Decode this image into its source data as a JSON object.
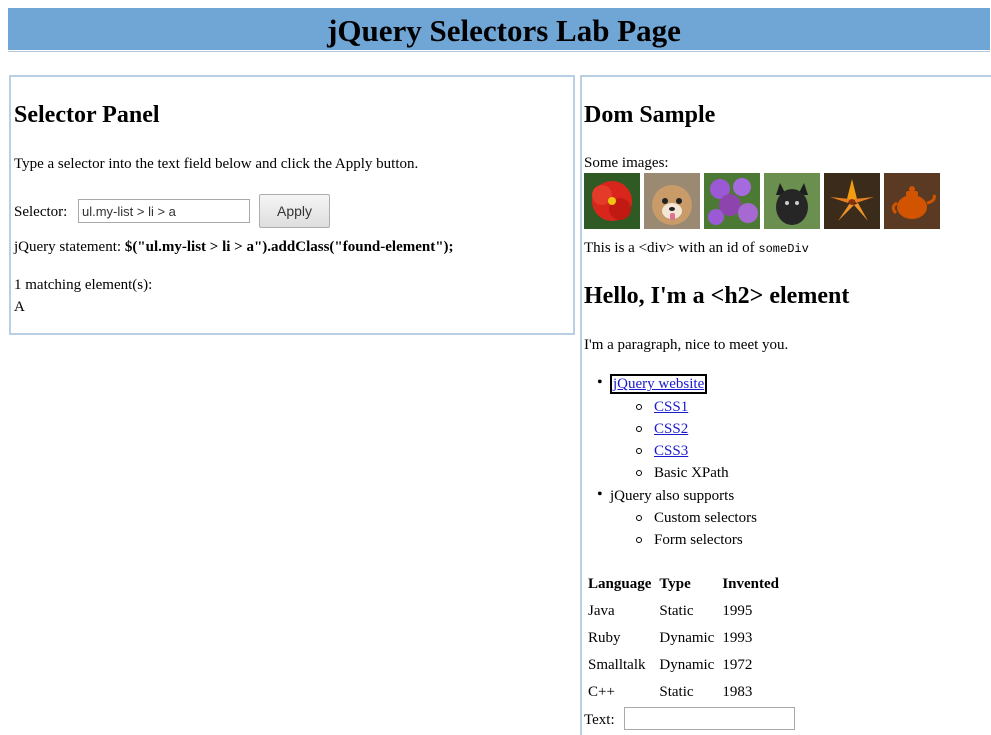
{
  "header": {
    "title": "jQuery Selectors Lab Page"
  },
  "selector_panel": {
    "title": "Selector Panel",
    "instructions": "Type a selector into the text field below and click the Apply button.",
    "selector_label": "Selector:",
    "selector_value": "ul.my-list > li > a",
    "apply_label": "Apply",
    "statement_label": "jQuery statement:",
    "statement_code": "$(\"ul.my-list > li > a\").addClass(\"found-element\");",
    "match_count": "1",
    "match_suffix": "matching element(s):",
    "match_result": "A"
  },
  "dom_panel": {
    "title": "Dom Sample",
    "images_label": "Some images:",
    "images": [
      {
        "name": "red-hibiscus-flower-image",
        "color": "#c0392b"
      },
      {
        "name": "dog-image",
        "color": "#8a6a4f"
      },
      {
        "name": "purple-flowers-image",
        "color": "#8e5bc4"
      },
      {
        "name": "black-dog-image",
        "color": "#2e2e2e"
      },
      {
        "name": "orange-lily-image",
        "color": "#e67e22"
      },
      {
        "name": "teapot-image",
        "color": "#c65a1e"
      }
    ],
    "div_text_prefix": "This is a <div> with an id of",
    "div_id": "someDiv",
    "h2_text": "Hello, I'm a <h2> element",
    "paragraph": "I'm a paragraph, nice to meet you.",
    "list": {
      "item1": "jQuery website",
      "item1_children": [
        "CSS1",
        "CSS2",
        "CSS3",
        "Basic XPath"
      ],
      "item2": "jQuery also supports",
      "item2_children": [
        "Custom selectors",
        "Form selectors"
      ]
    },
    "table": {
      "headers": [
        "Language",
        "Type",
        "Invented"
      ],
      "rows": [
        [
          "Java",
          "Static",
          "1995"
        ],
        [
          "Ruby",
          "Dynamic",
          "1993"
        ],
        [
          "Smalltalk",
          "Dynamic",
          "1972"
        ],
        [
          "C++",
          "Static",
          "1983"
        ]
      ]
    },
    "text_label": "Text:",
    "text_value": ""
  }
}
